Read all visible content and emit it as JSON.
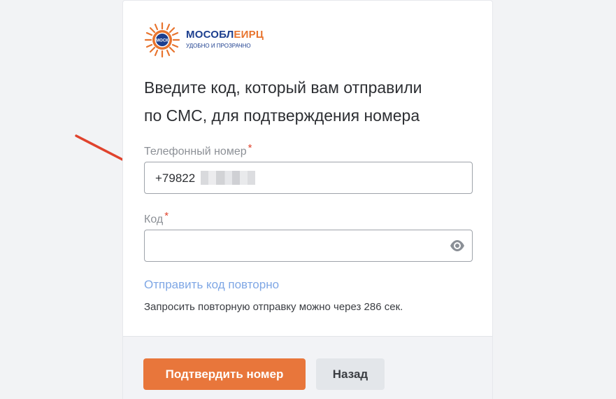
{
  "brand": {
    "name_part1": "МОСОБЛ",
    "name_part2": "ЕИРЦ",
    "tagline": "УДОБНО И ПРОЗРАЧНО",
    "mark_text": "МОСК",
    "primary_color": "#1d3f8f",
    "accent_color": "#e8742e"
  },
  "form": {
    "heading_line1": "Введите код, который вам отправили",
    "heading_line2": "по СМС, для подтверждения номера",
    "phone": {
      "label": "Телефонный номер",
      "required_mark": "*",
      "value": "+79822"
    },
    "code": {
      "label": "Код",
      "required_mark": "*",
      "value": "",
      "toggle_icon": "eye-icon"
    },
    "resend_link": "Отправить код повторно",
    "timer_text": "Запросить повторную отправку можно через 286 сек."
  },
  "actions": {
    "confirm_label": "Подтвердить номер",
    "back_label": "Назад",
    "confirm_color": "#e8763b"
  },
  "annotation": {
    "icon": "red-arrow-icon",
    "color": "#e0432d"
  }
}
